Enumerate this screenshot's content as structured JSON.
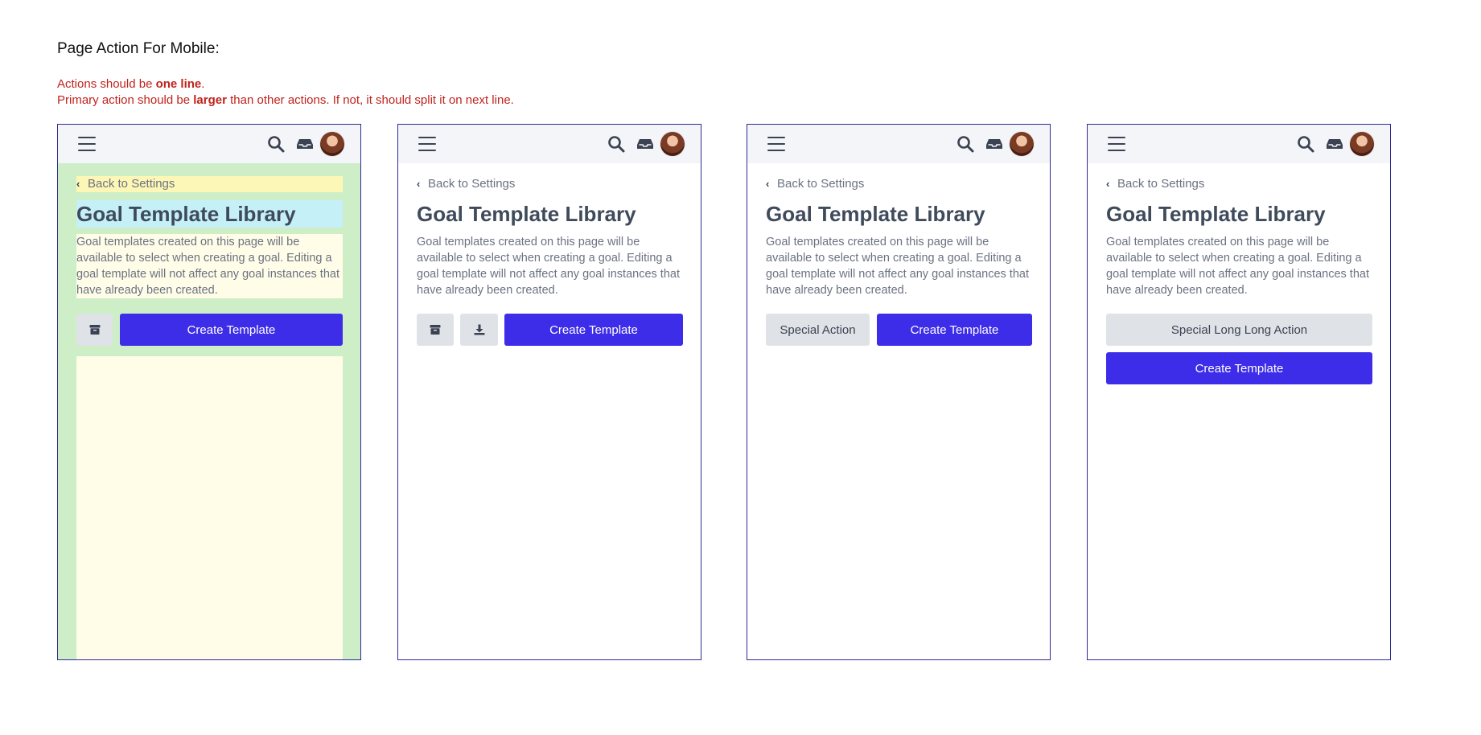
{
  "heading": "Page Action For Mobile:",
  "notes": {
    "line1_pre": "Actions should be ",
    "line1_bold": "one line",
    "line1_post": ".",
    "line2_pre": "Primary action should be ",
    "line2_bold": "larger",
    "line2_post": " than other actions. If not, it should split it on next line."
  },
  "colors": {
    "note_red": "#c0231c",
    "frame_border": "#2f2a95",
    "primary": "#3d2de8",
    "secondary": "#dfe3e8",
    "topbar": "#f4f5f9",
    "annot_green": "#cdeec6",
    "annot_yellow": "#fdf7b7",
    "annot_cyan": "#c6f0f8",
    "annot_cream": "#fffde8"
  },
  "icons": {
    "menu": "hamburger-menu-icon",
    "search": "search-icon",
    "inbox": "inbox-icon",
    "back": "chevron-left-icon",
    "archive": "archive-icon",
    "download": "download-icon"
  },
  "screen": {
    "back_link": "Back to Settings",
    "title": "Goal Template Library",
    "description": "Goal templates created on this page will be available to select when creating a goal. Editing a goal template will not affect any goal instances that have already been created.",
    "primary_action": "Create Template"
  },
  "mockups": {
    "m3_secondary": "Special Action",
    "m4_secondary": "Special Long Long Action"
  }
}
